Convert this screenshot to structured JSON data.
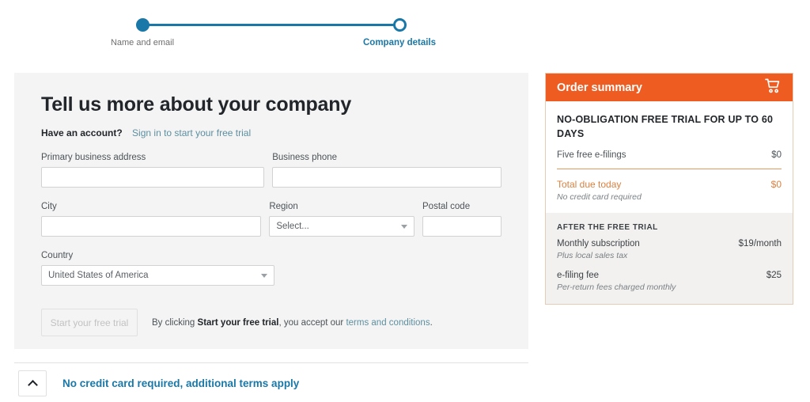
{
  "stepper": {
    "steps": [
      {
        "label": "Name and email",
        "state": "completed"
      },
      {
        "label": "Company details",
        "state": "current"
      }
    ]
  },
  "form": {
    "title": "Tell us more about your company",
    "account_question": "Have an account?",
    "signin_link": "Sign in to start your free trial",
    "fields": {
      "address": {
        "label": "Primary business address",
        "value": "",
        "placeholder": ""
      },
      "phone": {
        "label": "Business phone",
        "value": "",
        "placeholder": ""
      },
      "city": {
        "label": "City",
        "value": "",
        "placeholder": ""
      },
      "region": {
        "label": "Region",
        "value": "Select..."
      },
      "postal": {
        "label": "Postal code",
        "value": "",
        "placeholder": ""
      },
      "country": {
        "label": "Country",
        "value": "United States of America"
      }
    },
    "submit_label": "Start your free trial",
    "terms_prefix": "By clicking ",
    "terms_bold": "Start your free trial",
    "terms_middle": ", you accept our ",
    "terms_link": "terms and conditions",
    "terms_suffix": "."
  },
  "order_summary": {
    "header_title": "Order summary",
    "cart_icon": "shopping-cart-icon",
    "promo_title": "NO-OBLIGATION FREE TRIAL FOR UP TO 60 DAYS",
    "promo_item_label": "Five free e-filings",
    "promo_item_price": "$0",
    "total_label": "Total due today",
    "total_price": "$0",
    "total_note": "No credit card required",
    "after_trial_title": "AFTER THE FREE TRIAL",
    "after_items": [
      {
        "label": "Monthly subscription",
        "price": "$19/month",
        "note": "Plus local sales tax"
      },
      {
        "label": "e-filing fee",
        "price": "$25",
        "note": "Per-return fees charged monthly"
      }
    ]
  },
  "accordion": {
    "toggle_icon": "chevron-up-icon",
    "label": "No credit card required, additional terms apply"
  },
  "colors": {
    "brand_orange": "#ef5c22",
    "brand_blue": "#1a78a8",
    "link_blue": "#5d8fa0",
    "panel_gray": "#f4f4f4",
    "total_orange": "#d9813f"
  }
}
